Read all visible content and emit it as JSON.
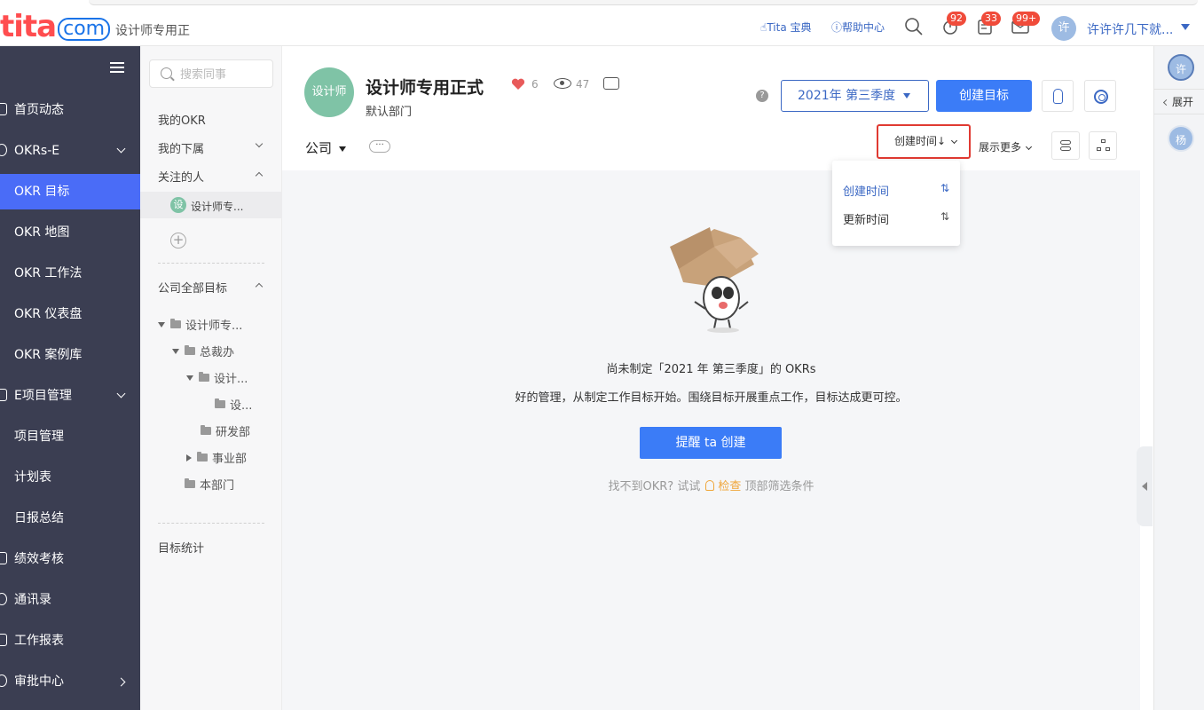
{
  "header": {
    "company_name": "设计师专用正",
    "links": {
      "tita_guide": "Tita 宝典",
      "help_center": "帮助中心"
    },
    "badges": {
      "remind": "92",
      "task": "33",
      "message": "99+"
    },
    "user": {
      "avatar": "许",
      "name": "许许许几下就..."
    },
    "logo": {
      "main": "tita",
      "suffix": "com"
    }
  },
  "sidebar": {
    "items": [
      {
        "label": "首页动态"
      },
      {
        "label": "OKRs-E"
      },
      {
        "label": "OKR 目标"
      },
      {
        "label": "OKR 地图"
      },
      {
        "label": "OKR 工作法"
      },
      {
        "label": "OKR 仪表盘"
      },
      {
        "label": "OKR 案例库"
      },
      {
        "label": "E项目管理"
      },
      {
        "label": "项目管理"
      },
      {
        "label": "计划表"
      },
      {
        "label": "日报总结"
      },
      {
        "label": "绩效考核"
      },
      {
        "label": "通讯录"
      },
      {
        "label": "工作报表"
      },
      {
        "label": "审批中心"
      }
    ]
  },
  "col2": {
    "search_placeholder": "搜索同事",
    "my_okr": "我的OKR",
    "my_reports": "我的下属",
    "followed": "关注的人",
    "followed_user_avatar": "设",
    "followed_user": "设计师专...",
    "company_goals": "公司全部目标",
    "tree": [
      "设计师专...",
      "总裁办",
      "设计...",
      "设...",
      "研发部",
      "事业部",
      "本部门"
    ],
    "goal_stats": "目标统计"
  },
  "main": {
    "avatar": "设计师",
    "title": "设计师专用正式",
    "subtitle": "默认部门",
    "likes": "6",
    "views": "47",
    "help": "?",
    "period": "2021年 第三季度",
    "create_label": "创建目标",
    "filter": "公司",
    "more": "···",
    "sort_label": "创建时间↓",
    "show_more": "展示更多",
    "dropdown": [
      {
        "label": "创建时间",
        "sort": "⇅"
      },
      {
        "label": "更新时间",
        "sort": "⇅"
      }
    ],
    "empty": {
      "title": "尚未制定「2021 年 第三季度」的 OKRs",
      "desc": "好的管理，从制定工作目标开始。围绕目标开展重点工作，目标达成更可控。",
      "button": "提醒 ta 创建",
      "hint_pre": "找不到OKR? 试试",
      "hint_link": "检查",
      "hint_post": "顶部筛选条件"
    }
  },
  "right_panel": {
    "avatar1": "许",
    "expand": "展开",
    "avatar2": "杨"
  }
}
